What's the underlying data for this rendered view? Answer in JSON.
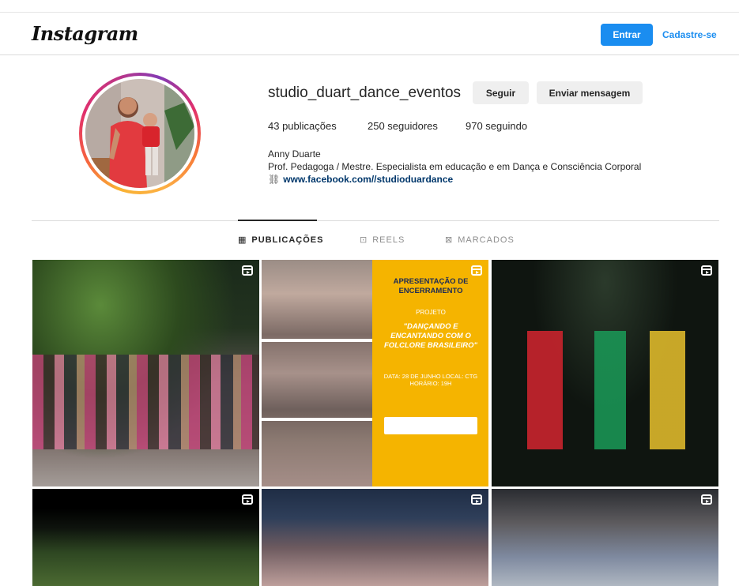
{
  "header": {
    "logo": "Instagram",
    "login_label": "Entrar",
    "signup_label": "Cadastre-se"
  },
  "profile": {
    "username": "studio_duart_dance_eventos",
    "follow_label": "Seguir",
    "message_label": "Enviar mensagem",
    "stats": {
      "posts": "43 publicações",
      "followers": "250 seguidores",
      "following": "970 seguindo"
    },
    "bio": {
      "name": "Anny Duarte",
      "text": "Prof. Pedagoga / Mestre. Especialista em educação e em Dança e Consciência Corporal",
      "link": "www.facebook.com//studioduardance"
    }
  },
  "tabs": [
    {
      "label": "PUBLICAÇÕES",
      "icon": "grid-icon"
    },
    {
      "label": "REELS",
      "icon": "reels-icon"
    },
    {
      "label": "MARCADOS",
      "icon": "tagged-icon"
    }
  ],
  "poster": {
    "title": "APRESENTAÇÃO DE ENCERRAMENTO",
    "project": "PROJETO",
    "name": "\"DANÇANDO E ENCANTANDO COM O FOLCLORE BRASILEIRO\"",
    "details": "DATA: 28 DE JUNHO LOCAL: CTG HORÁRIO: 19H"
  },
  "colors": {
    "primary_button": "#1a8df0",
    "secondary_button": "#efefef",
    "link": "#00376b"
  }
}
